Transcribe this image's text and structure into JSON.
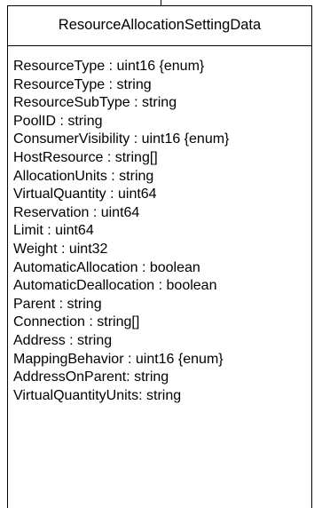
{
  "class_box": {
    "name": "ResourceAllocationSettingData",
    "attributes": [
      "ResourceType : uint16 {enum}",
      "ResourceType : string",
      "ResourceSubType : string",
      "PoolID : string",
      "ConsumerVisibility : uint16 {enum}",
      "HostResource : string[]",
      "AllocationUnits : string",
      "VirtualQuantity : uint64",
      "Reservation : uint64",
      "Limit : uint64",
      "Weight : uint32",
      "AutomaticAllocation : boolean",
      "AutomaticDeallocation : boolean",
      "Parent : string",
      "Connection : string[]",
      "Address : string",
      "MappingBehavior : uint16 {enum}",
      "AddressOnParent: string",
      "VirtualQuantityUnits: string"
    ]
  }
}
